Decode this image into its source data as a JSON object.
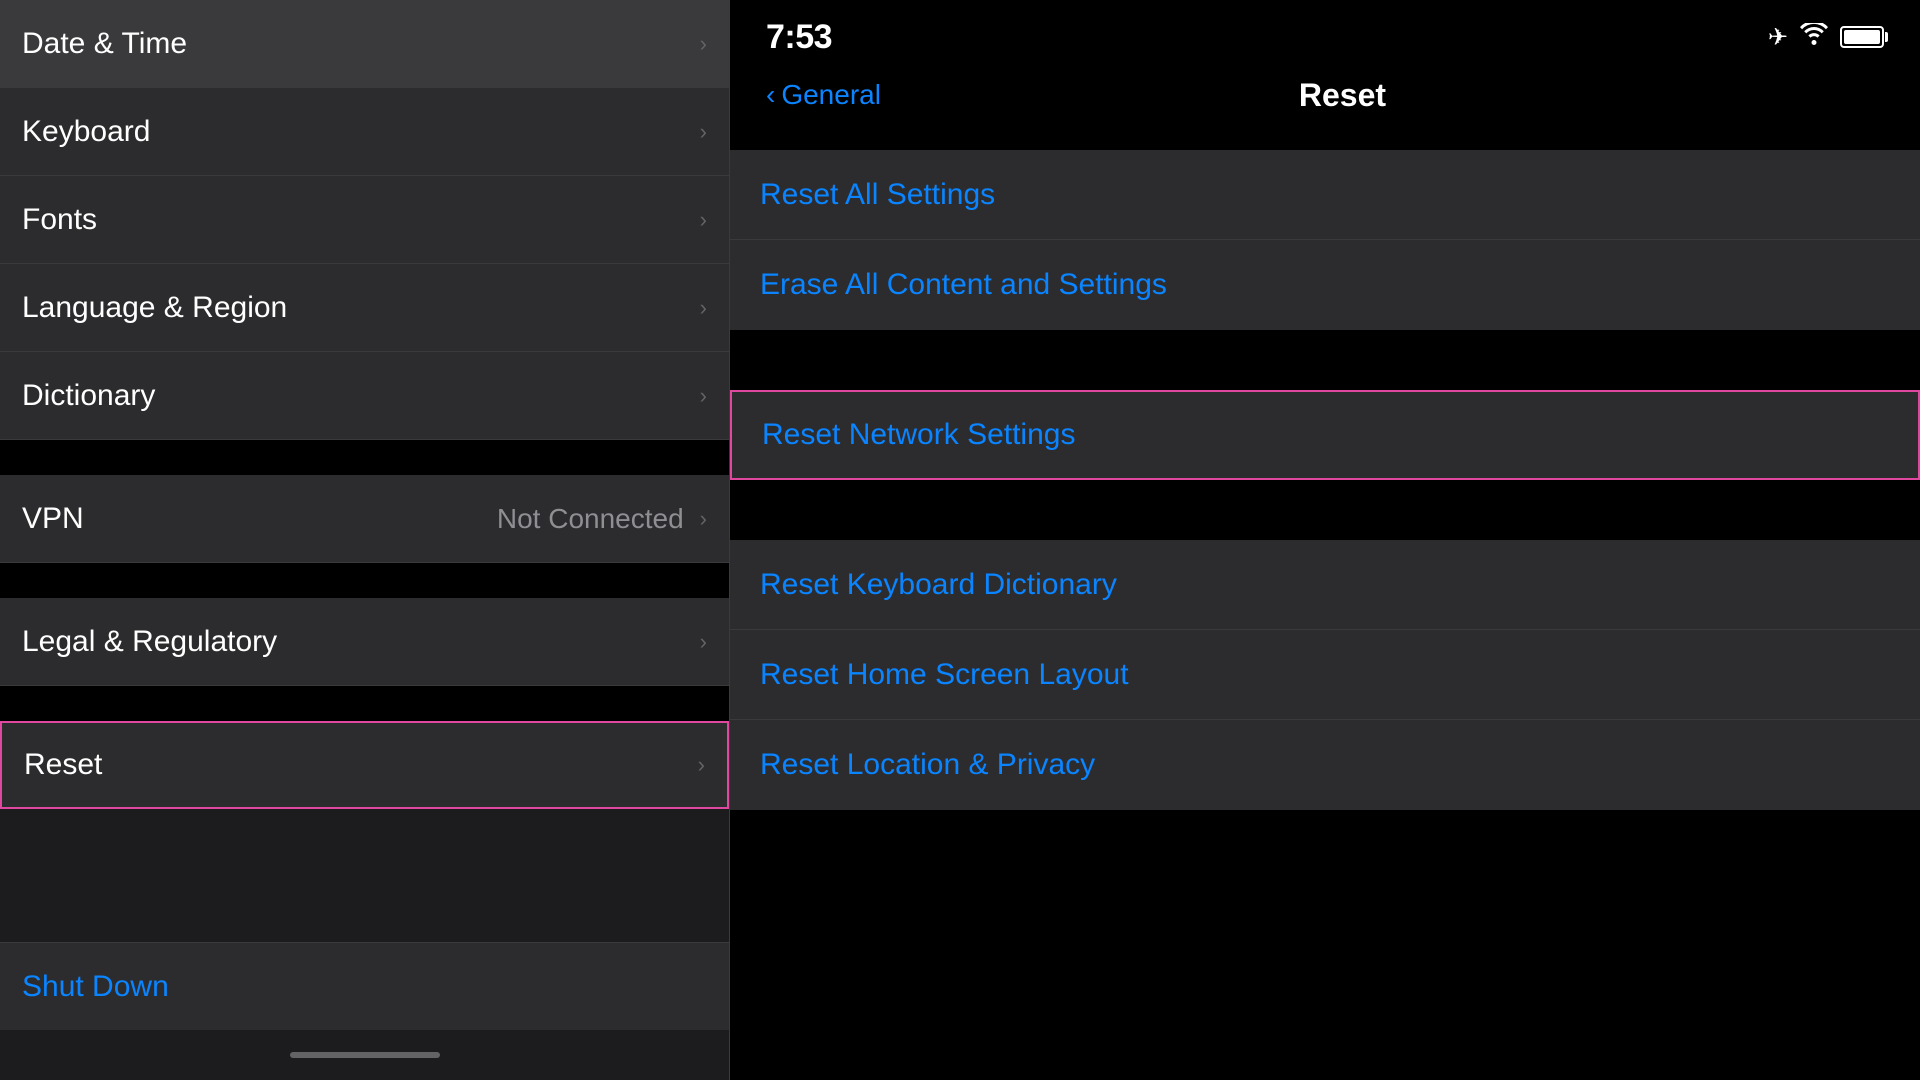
{
  "left": {
    "items": [
      {
        "id": "date-time",
        "label": "Date & Time",
        "value": "",
        "chevron": true
      },
      {
        "id": "keyboard",
        "label": "Keyboard",
        "value": "",
        "chevron": true
      },
      {
        "id": "fonts",
        "label": "Fonts",
        "value": "",
        "chevron": true
      },
      {
        "id": "language-region",
        "label": "Language & Region",
        "value": "",
        "chevron": true
      },
      {
        "id": "dictionary",
        "label": "Dictionary",
        "value": "",
        "chevron": true
      },
      {
        "id": "vpn",
        "label": "VPN",
        "value": "Not Connected",
        "chevron": true
      },
      {
        "id": "legal-regulatory",
        "label": "Legal & Regulatory",
        "value": "",
        "chevron": true
      },
      {
        "id": "reset",
        "label": "Reset",
        "value": "",
        "chevron": true,
        "highlighted": true
      }
    ],
    "shutdown_label": "Shut Down"
  },
  "right": {
    "status": {
      "time": "7:53"
    },
    "nav": {
      "back_label": "General",
      "title": "Reset"
    },
    "sections": {
      "group1": [
        {
          "id": "reset-all-settings",
          "label": "Reset All Settings",
          "highlighted": false
        },
        {
          "id": "erase-all",
          "label": "Erase All Content and Settings",
          "highlighted": false
        }
      ],
      "group2": [
        {
          "id": "reset-network",
          "label": "Reset Network Settings",
          "highlighted": true
        }
      ],
      "group3": [
        {
          "id": "reset-keyboard",
          "label": "Reset Keyboard Dictionary",
          "highlighted": false
        },
        {
          "id": "reset-home-screen",
          "label": "Reset Home Screen Layout",
          "highlighted": false
        },
        {
          "id": "reset-location-privacy",
          "label": "Reset Location & Privacy",
          "highlighted": false
        }
      ]
    }
  }
}
